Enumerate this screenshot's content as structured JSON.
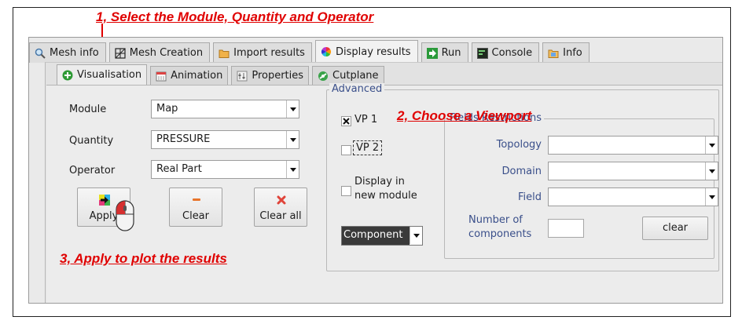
{
  "annotations": {
    "step1": "1, Select the Module, Quantity and Operator",
    "step2": "2,  Choose a Viewport",
    "step3": "3,  Apply to plot the results",
    "color": "#e00000"
  },
  "main_tabs": [
    {
      "label": "Mesh info",
      "icon": "magnifier-icon"
    },
    {
      "label": "Mesh Creation",
      "icon": "mesh-grid-icon"
    },
    {
      "label": "Import results",
      "icon": "folder-icon"
    },
    {
      "label": "Display results",
      "icon": "color-wheel-icon",
      "active": true
    },
    {
      "label": "Run",
      "icon": "run-arrow-icon"
    },
    {
      "label": "Console",
      "icon": "console-icon"
    },
    {
      "label": "Info",
      "icon": "info-folder-icon"
    }
  ],
  "sub_tabs": [
    {
      "label": "Visualisation",
      "icon": "green-plus-icon",
      "active": true
    },
    {
      "label": "Animation",
      "icon": "calendar-icon"
    },
    {
      "label": "Properties",
      "icon": "properties-icon"
    },
    {
      "label": "Cutplane",
      "icon": "cutplane-icon"
    }
  ],
  "form": {
    "module_label": "Module",
    "module_value": "Map",
    "quantity_label": "Quantity",
    "quantity_value": "PRESSURE",
    "operator_label": "Operator",
    "operator_value": "Real Part"
  },
  "buttons": {
    "apply": "Apply",
    "clear": "Clear",
    "clear_all": "Clear all"
  },
  "advanced": {
    "title": "Advanced",
    "vp1_label": "VP 1",
    "vp1_checked": true,
    "vp2_label": "VP 2",
    "vp2_checked": false,
    "display_new_module_line1": "Display in",
    "display_new_module_line2": "new module",
    "component_value": "Component"
  },
  "fields_restrictions": {
    "title": "Fields Restrictions",
    "topology_label": "Topology",
    "domain_label": "Domain",
    "field_label": "Field",
    "num_components_line1": "Number of",
    "num_components_line2": "components",
    "clear_button": "clear"
  }
}
